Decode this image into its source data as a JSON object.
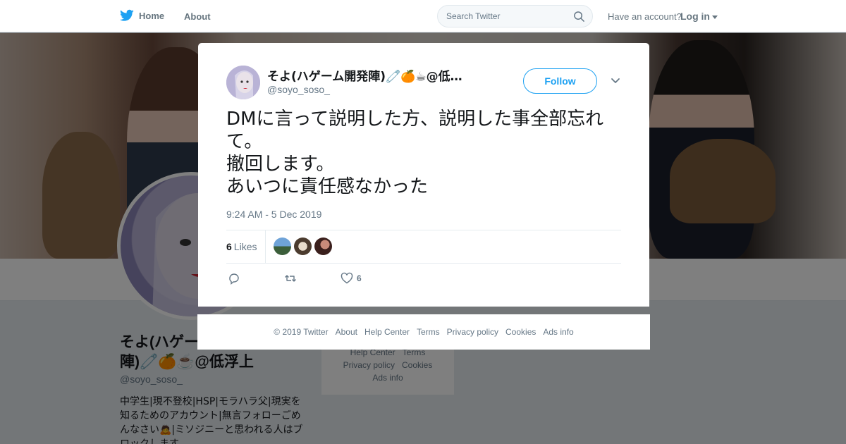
{
  "topbar": {
    "home_label": "Home",
    "about_label": "About",
    "search_placeholder": "Search Twitter",
    "have_account": "Have an account?",
    "login_label": "Log in"
  },
  "profile": {
    "name": "そよ(ハゲー…陣)🧷🍊☕@低浮上",
    "name_line1": "そよ(ハゲー",
    "name_line2": "陣)🧷🍊☕@低浮上",
    "handle": "@soyo_soso_",
    "bio": "中学生|現不登校|HSP|モラハラ父|現実を知るためのアカウント|無言フォローごめんなさい🙇|ミソジニーと思われる人はブロックします"
  },
  "side_card": {
    "links": [
      "Help Center",
      "Terms",
      "Privacy policy",
      "Cookies",
      "Ads info"
    ]
  },
  "tweet": {
    "author_name": "そよ(ハゲーム開発陣)🧷🍊☕@低…",
    "author_handle": "@soyo_soso_",
    "follow_label": "Follow",
    "text": "DMに言って説明した方、説明した事全部忘れて。\n撤回します。\nあいつに責任感なかった",
    "timestamp": "9:24 AM - 5 Dec 2019",
    "likes_count": "6",
    "likes_label": "Likes",
    "action_like_count": "6"
  },
  "footer": {
    "copyright": "© 2019 Twitter",
    "links": [
      "About",
      "Help Center",
      "Terms",
      "Privacy policy",
      "Cookies",
      "Ads info"
    ]
  },
  "colors": {
    "accent": "#1da1f2",
    "muted": "#657786",
    "text": "#14171a"
  }
}
